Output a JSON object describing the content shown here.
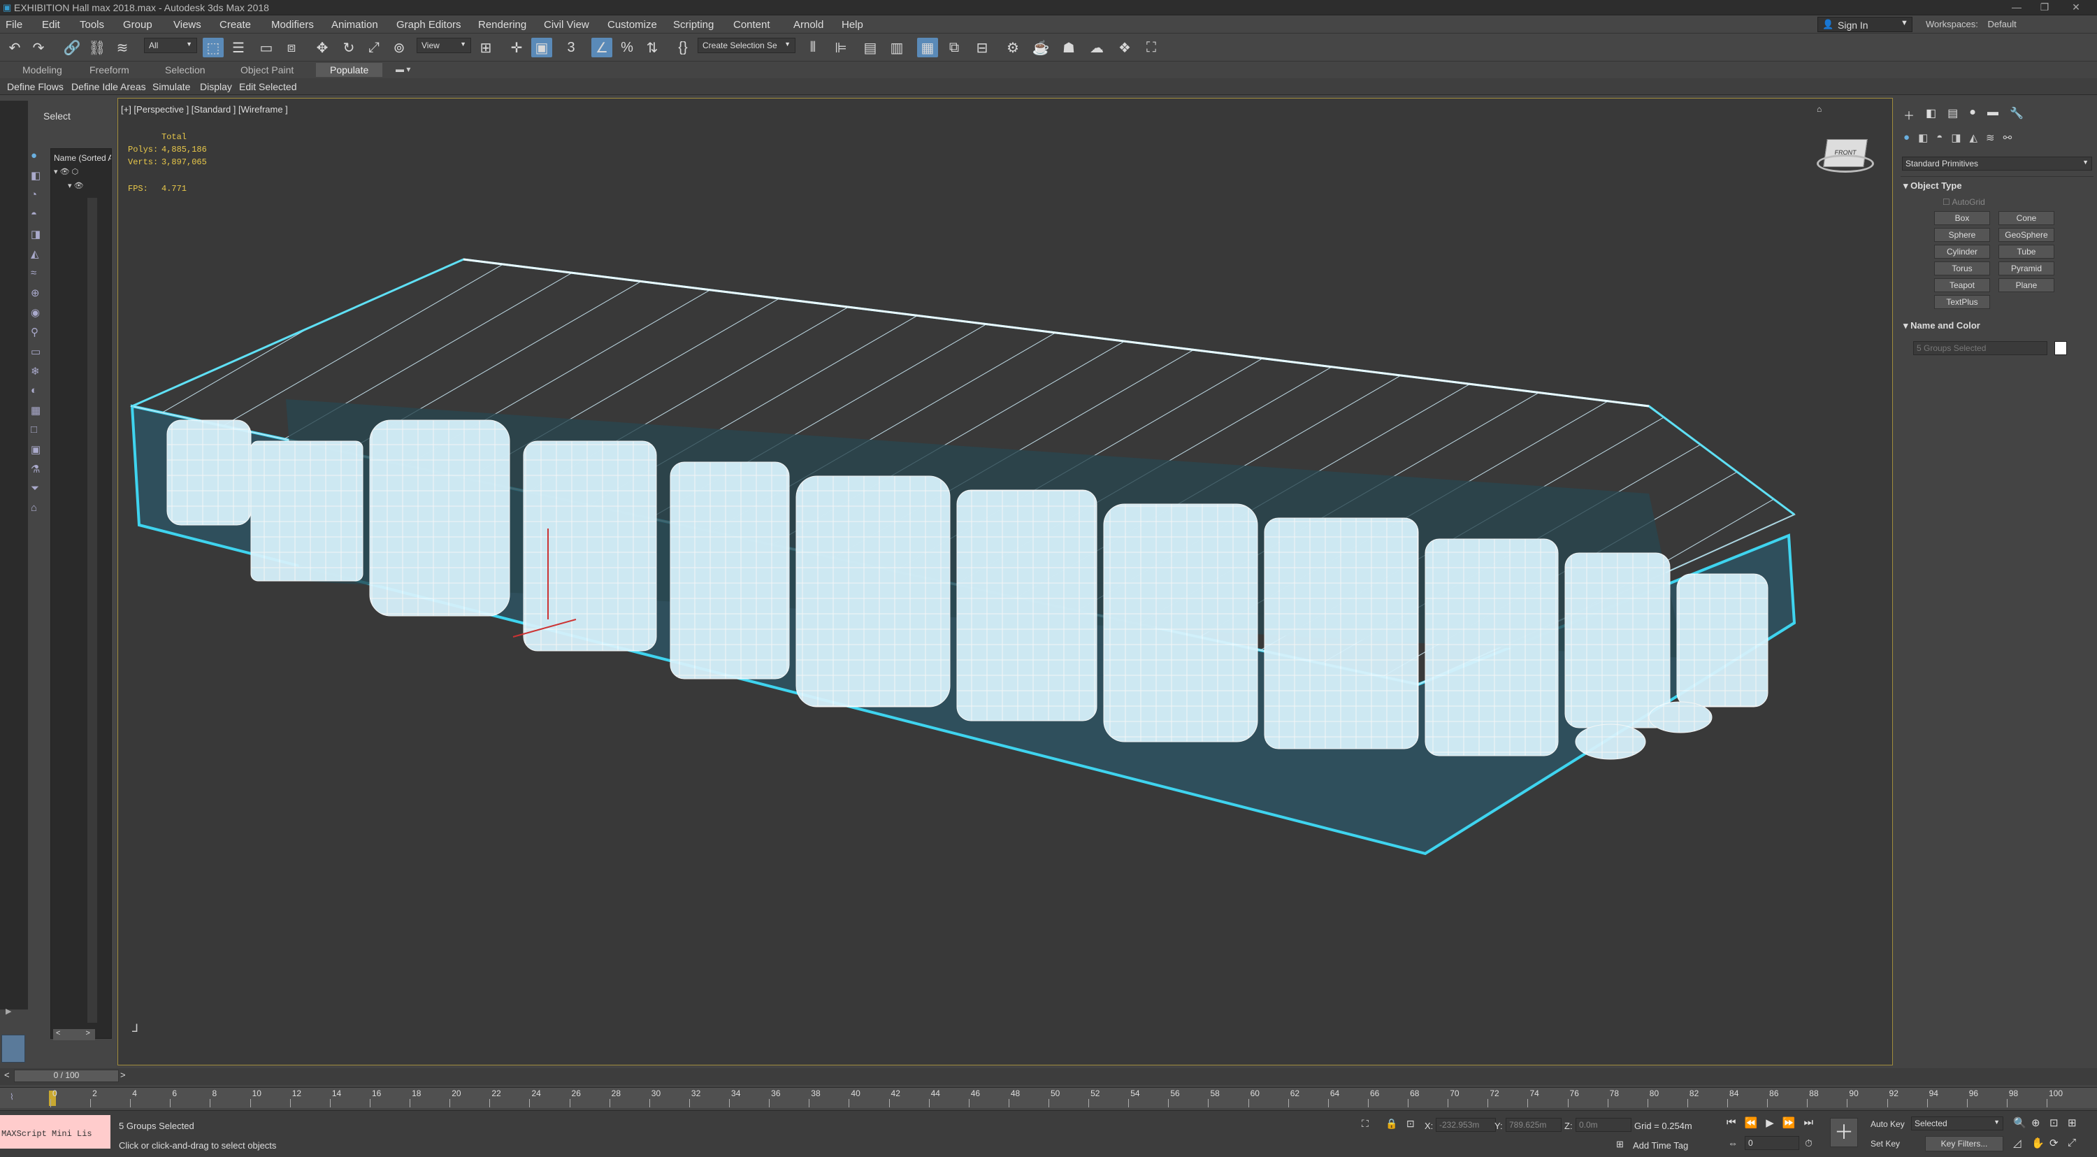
{
  "window": {
    "title": "EXHIBITION Hall max 2018.max - Autodesk 3ds Max 2018"
  },
  "menu": [
    "File",
    "Edit",
    "Tools",
    "Group",
    "Views",
    "Create",
    "Modifiers",
    "Animation",
    "Graph Editors",
    "Rendering",
    "Civil View",
    "Customize",
    "Scripting",
    "Content",
    "Arnold",
    "Help"
  ],
  "account": {
    "sign_in": "Sign In",
    "workspace_label": "Workspaces:",
    "workspace_value": "Default"
  },
  "toolbar": {
    "filter_value": "All",
    "ref_coord_value": "View",
    "selection_set_placeholder": "Create Selection Se"
  },
  "ribbon_tabs": [
    "Modeling",
    "Freeform",
    "Selection",
    "Object Paint",
    "Populate"
  ],
  "ribbon_active": "Populate",
  "ribbon_commands": [
    "Define Flows",
    "Define Idle Areas",
    "Simulate",
    "Display",
    "Edit Selected"
  ],
  "scene_explorer": {
    "tab": "Select",
    "column_header": "Name (Sorted A"
  },
  "viewport": {
    "label": "[+] [Perspective ] [Standard ] [Wireframe ]",
    "stats": {
      "total_label": "Total",
      "polys_label": "Polys:",
      "polys_value": "4,885,186",
      "verts_label": "Verts:",
      "verts_value": "3,897,065",
      "fps_label": "FPS:",
      "fps_value": "4.771"
    },
    "viewcube_label": "FRONT"
  },
  "command_panel": {
    "category_value": "Standard Primitives",
    "object_type_title": "Object Type",
    "autogrid_label": "AutoGrid",
    "buttons": [
      "Box",
      "Cone",
      "Sphere",
      "GeoSphere",
      "Cylinder",
      "Tube",
      "Torus",
      "Pyramid",
      "Teapot",
      "Plane",
      "TextPlus"
    ],
    "name_color_title": "Name and Color",
    "name_value": "5 Groups Selected"
  },
  "timeline": {
    "frame_display": "0 / 100",
    "ticks": [
      "0",
      "2",
      "4",
      "6",
      "8",
      "10",
      "12",
      "14",
      "16",
      "18",
      "20",
      "22",
      "24",
      "26",
      "28",
      "30",
      "32",
      "34",
      "36",
      "38",
      "40",
      "42",
      "44",
      "46",
      "48",
      "50",
      "52",
      "54",
      "56",
      "58",
      "60",
      "62",
      "64",
      "66",
      "68",
      "70",
      "72",
      "74",
      "76",
      "78",
      "80",
      "82",
      "84",
      "86",
      "88",
      "90",
      "92",
      "94",
      "96",
      "98",
      "100"
    ]
  },
  "status": {
    "maxscript_label": "MAXScript Mini Lis",
    "selection_text": "5 Groups Selected",
    "prompt_text": "Click or click-and-drag to select objects",
    "x_label": "X:",
    "x_value": "-232.953m",
    "y_label": "Y:",
    "y_value": "789.625m",
    "z_label": "Z:",
    "z_value": "0.0m",
    "grid_text": "Grid = 0.254m",
    "add_time_tag": "Add Time Tag",
    "auto_key": "Auto Key",
    "set_key": "Set Key",
    "selected_value": "Selected",
    "key_filters": "Key Filters...",
    "frame_value": "0"
  }
}
